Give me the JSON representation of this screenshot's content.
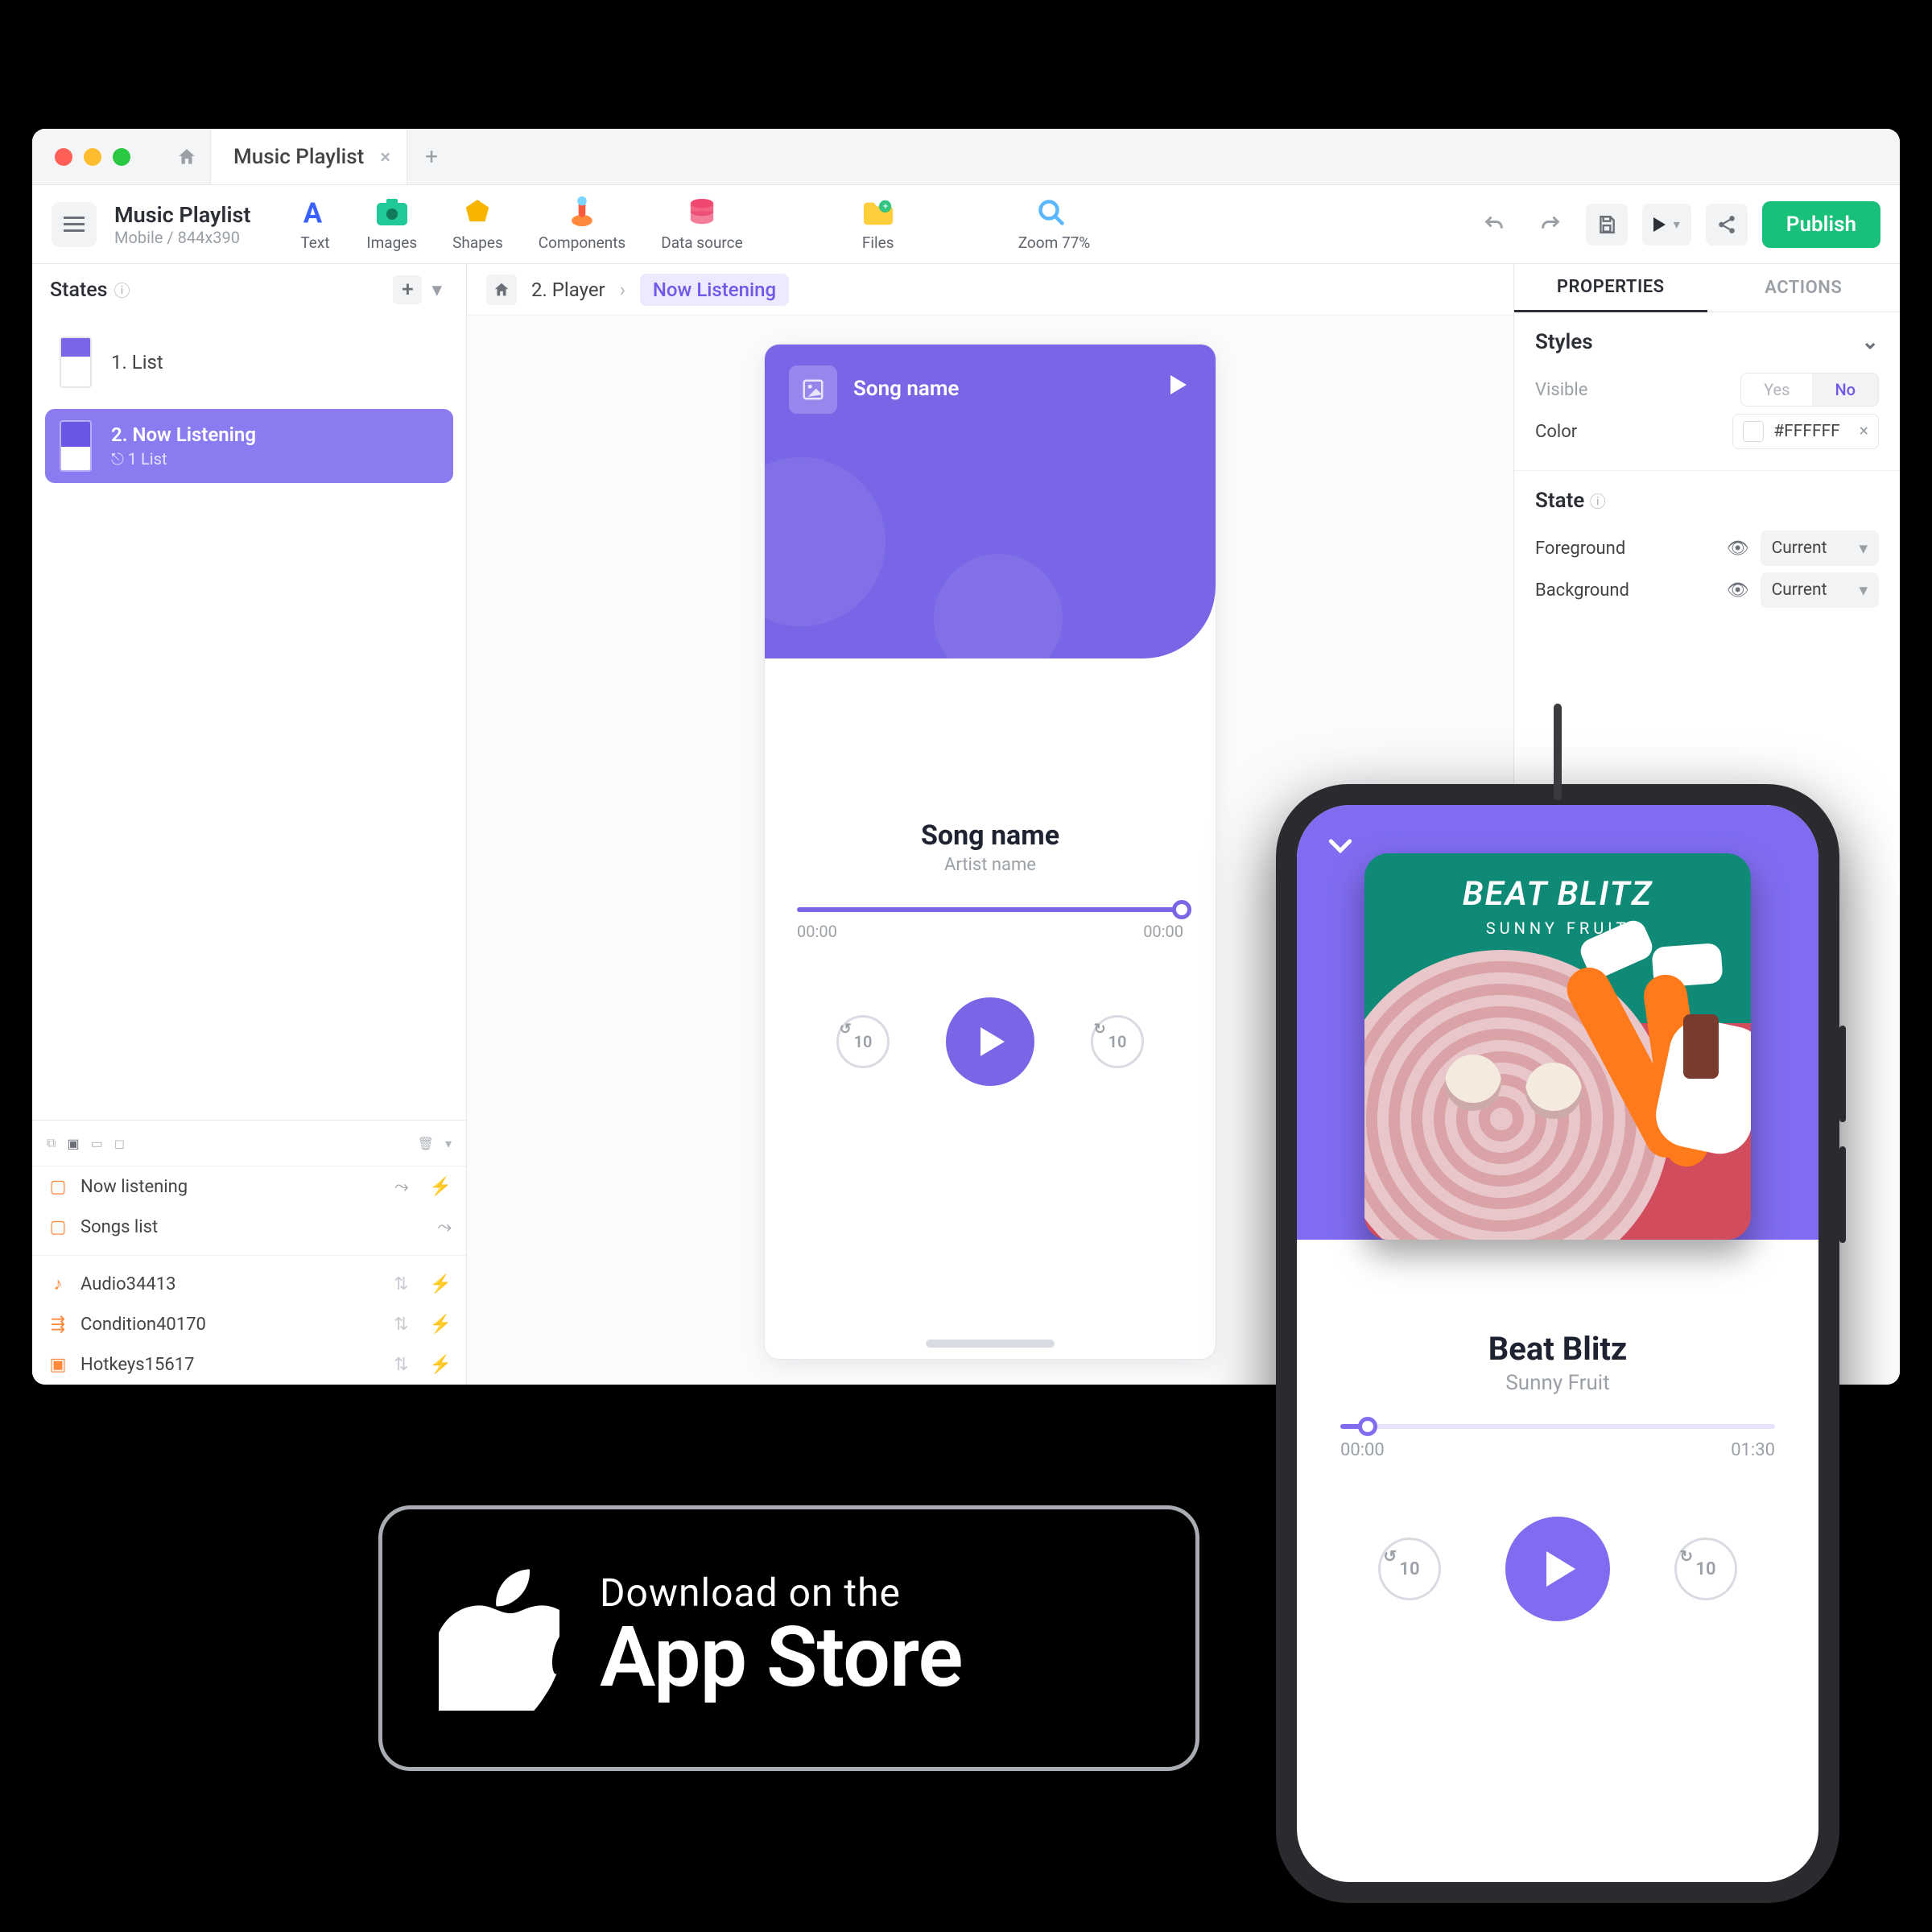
{
  "window": {
    "tab_title": "Music Playlist",
    "project_title": "Music Playlist",
    "project_subtitle": "Mobile / 844x390"
  },
  "toolbar": {
    "text": "Text",
    "images": "Images",
    "shapes": "Shapes",
    "components": "Components",
    "datasource": "Data source",
    "files": "Files",
    "zoom": "Zoom 77%",
    "publish": "Publish"
  },
  "states": {
    "heading": "States",
    "item1": "1. List",
    "item2": "2. Now Listening",
    "item2_sub": "1  List"
  },
  "layers": {
    "a1": "Now listening",
    "a2": "Songs list",
    "b1": "Audio34413",
    "b2": "Condition40170",
    "b3": "Hotkeys15617"
  },
  "crumbs": {
    "c1": "2. Player",
    "c2": "Now Listening"
  },
  "editor_device": {
    "hero_song": "Song name",
    "song": "Song name",
    "artist": "Artist name",
    "t_start": "00:00",
    "t_end": "00:00",
    "skip_back": "10",
    "skip_fwd": "10"
  },
  "inspector": {
    "tab_props": "PROPERTIES",
    "tab_actions": "ACTIONS",
    "styles": "Styles",
    "visible": "Visible",
    "yes": "Yes",
    "no": "No",
    "color": "Color",
    "color_value": "#FFFFFF",
    "state": "State",
    "foreground": "Foreground",
    "background": "Background",
    "dd_value": "Current"
  },
  "phone": {
    "album_title": "BEAT BLITZ",
    "album_sub": "SUNNY FRUIT",
    "song": "Beat Blitz",
    "artist": "Sunny Fruit",
    "t_start": "00:00",
    "t_end": "01:30",
    "skip_back": "10",
    "skip_fwd": "10"
  },
  "appstore": {
    "line1": "Download on the",
    "line2": "App Store"
  }
}
